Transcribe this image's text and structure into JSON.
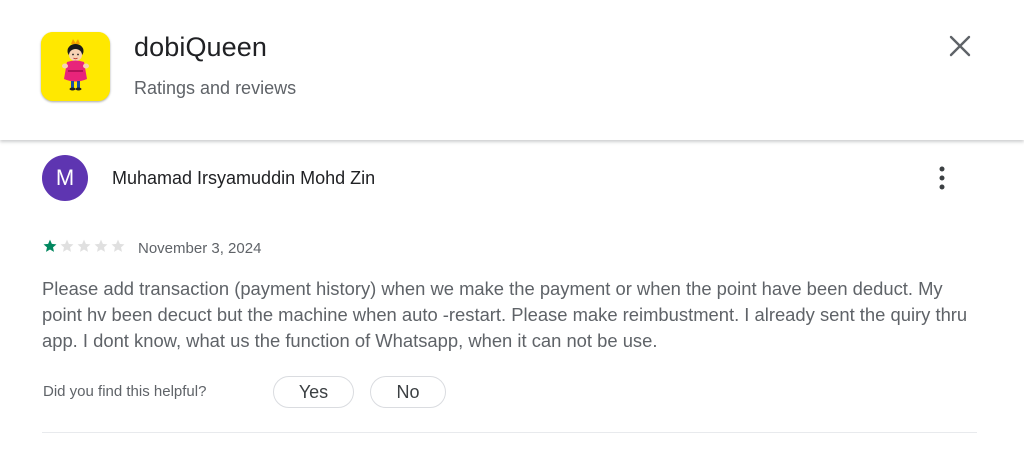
{
  "app": {
    "title": "dobiQueen",
    "subtitle": "Ratings and reviews",
    "icon": "dobiqueen-app-icon",
    "icon_bg": "#ffe800"
  },
  "header": {
    "close_icon": "close-icon"
  },
  "review": {
    "avatar_letter": "M",
    "avatar_color": "#5e35b1",
    "author": "Muhamad Irsyamuddin Mohd Zin",
    "more_icon": "more-vert-icon",
    "rating": 1,
    "max_rating": 5,
    "star_filled_color": "#01875f",
    "star_empty_color": "#e0e0e0",
    "date": "November 3, 2024",
    "text": "Please add transaction (payment history) when we make the payment or when the point have been deduct. My point hv been decuct but the machine when auto -restart. Please make reimbustment. I already sent the quiry thru app. I dont know, what us the function of Whatsapp, when it can not be use.",
    "helpful_prompt": "Did you find this helpful?",
    "yes_label": "Yes",
    "no_label": "No"
  }
}
